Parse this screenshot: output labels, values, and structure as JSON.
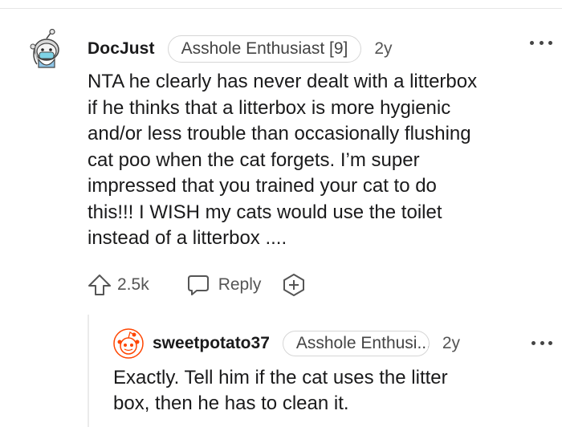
{
  "comment": {
    "username": "DocJust",
    "flair": "Asshole Enthusiast [9]",
    "age": "2y",
    "more_icon": "more-horizontal-icon",
    "body": "NTA he clearly has never dealt with a litterbox\nif he thinks that a litterbox is more hygienic\nand/or less trouble than occasionally flushing\ncat poo when the cat forgets. I’m super\nimpressed that you trained your cat to do\nthis!!! I WISH my cats would use the toilet\ninstead of a litterbox ....",
    "actions": {
      "upvote_icon": "upvote-arrow-icon",
      "score": "2.5k",
      "reply_icon": "speech-bubble-icon",
      "reply_label": "Reply",
      "award_icon": "award-plus-icon"
    }
  },
  "reply": {
    "username": "sweetpotato37",
    "flair": "Asshole Enthusi...",
    "age": "2y",
    "more_icon": "more-horizontal-icon",
    "body": "Exactly. Tell him if the cat uses the litter\nbox, then he has to clean it."
  },
  "colors": {
    "text": "#1a1a1b",
    "muted": "#555555",
    "border": "#d6d6d6",
    "snoo_orange": "#ff4500"
  }
}
